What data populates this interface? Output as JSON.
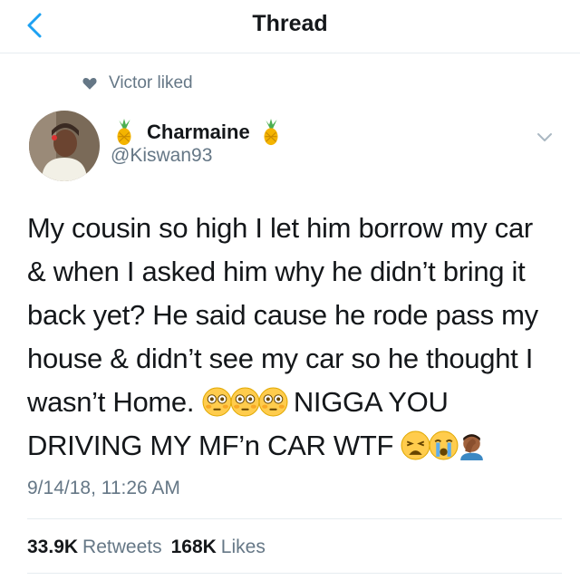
{
  "header": {
    "title": "Thread"
  },
  "social_context": {
    "text": "Victor liked"
  },
  "author": {
    "name": "Charmaine",
    "handle": "@Kiswan93"
  },
  "tweet": {
    "lines": [
      "My cousin so high I let him borrow my car",
      "& when I asked him why he didn’t bring it",
      "back yet? He said cause he rode pass my",
      "house & didn’t see my car so he thought I",
      "wasn’t Home.",
      "NIGGA YOU",
      "DRIVING MY MF’n CAR WTF"
    ],
    "timestamp": "9/14/18, 11:26 AM"
  },
  "stats": {
    "retweets_count": "33.9K",
    "retweets_label": "Retweets",
    "likes_count": "168K",
    "likes_label": "Likes"
  },
  "icons": [
    "back-chevron-icon",
    "heart-icon",
    "pineapple-icon",
    "chevron-down-icon",
    "flushed-face-icon",
    "weary-face-icon",
    "crying-face-icon",
    "facepalm-icon"
  ],
  "colors": {
    "accent": "#1da1f2",
    "secondary_text": "#657786",
    "primary_text": "#14171a"
  }
}
